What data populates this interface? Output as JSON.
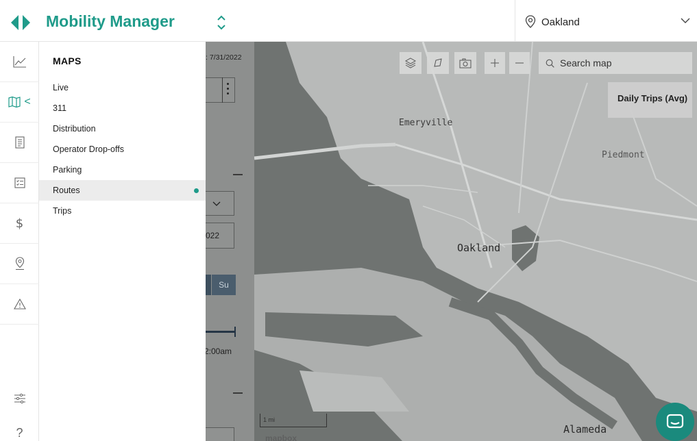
{
  "header": {
    "app_title": "Mobility Manager",
    "city": "Oakland",
    "brand_color": "#1f9b8a"
  },
  "rail": {
    "icons": [
      "trend-chart-icon",
      "map-icon",
      "report-icon",
      "checklist-icon",
      "dollar-icon",
      "location-pin-icon",
      "warning-icon",
      "sliders-icon",
      "help-icon"
    ],
    "dollar_glyph": "$",
    "help_glyph": "?",
    "map_chevron": "<"
  },
  "maps_menu": {
    "heading": "MAPS",
    "items": [
      {
        "label": "Live",
        "active": false
      },
      {
        "label": "311",
        "active": false
      },
      {
        "label": "Distribution",
        "active": false
      },
      {
        "label": "Operator Drop-offs",
        "active": false
      },
      {
        "label": "Parking",
        "active": false
      },
      {
        "label": "Routes",
        "active": true
      },
      {
        "label": "Trips",
        "active": false
      }
    ]
  },
  "under_panel": {
    "date_fragment": ": 7/31/2022",
    "date_field_fragment": "022",
    "day_label": "Su",
    "time_fragment": "2:00am"
  },
  "map": {
    "search_placeholder": "Search map",
    "layer_title": "Daily Trips (Avg)",
    "place_labels": [
      "Emeryville",
      "Piedmont",
      "Oakland",
      "Alameda"
    ],
    "scale_label": "1 mi",
    "attribution": "mapbox"
  }
}
